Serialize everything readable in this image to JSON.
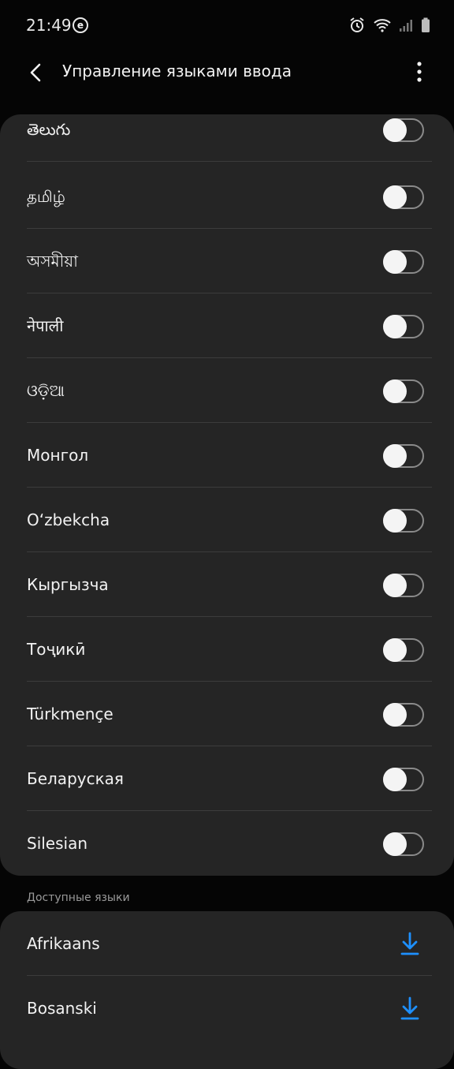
{
  "status": {
    "time": "21:49",
    "badge": "e"
  },
  "appbar": {
    "title": "Управление языками ввода"
  },
  "languages": [
    {
      "label": "తెలుగు",
      "enabled": false
    },
    {
      "label": "தமிழ்",
      "enabled": false
    },
    {
      "label": "অসমীয়া",
      "enabled": false
    },
    {
      "label": "नेपाली",
      "enabled": false
    },
    {
      "label": "ଓଡ଼ିଆ",
      "enabled": false
    },
    {
      "label": "Монгол",
      "enabled": false
    },
    {
      "label": "O‘zbekcha",
      "enabled": false
    },
    {
      "label": "Кыргызча",
      "enabled": false
    },
    {
      "label": "Тоҷикӣ",
      "enabled": false
    },
    {
      "label": "Türkmençe",
      "enabled": false
    },
    {
      "label": "Беларуская",
      "enabled": false
    },
    {
      "label": "Silesian",
      "enabled": false
    }
  ],
  "available": {
    "header": "Доступные языки",
    "items": [
      {
        "label": "Afrikaans"
      },
      {
        "label": "Bosanski"
      }
    ]
  },
  "colors": {
    "accent": "#1e90ff",
    "card": "#252525",
    "background": "#050505"
  }
}
